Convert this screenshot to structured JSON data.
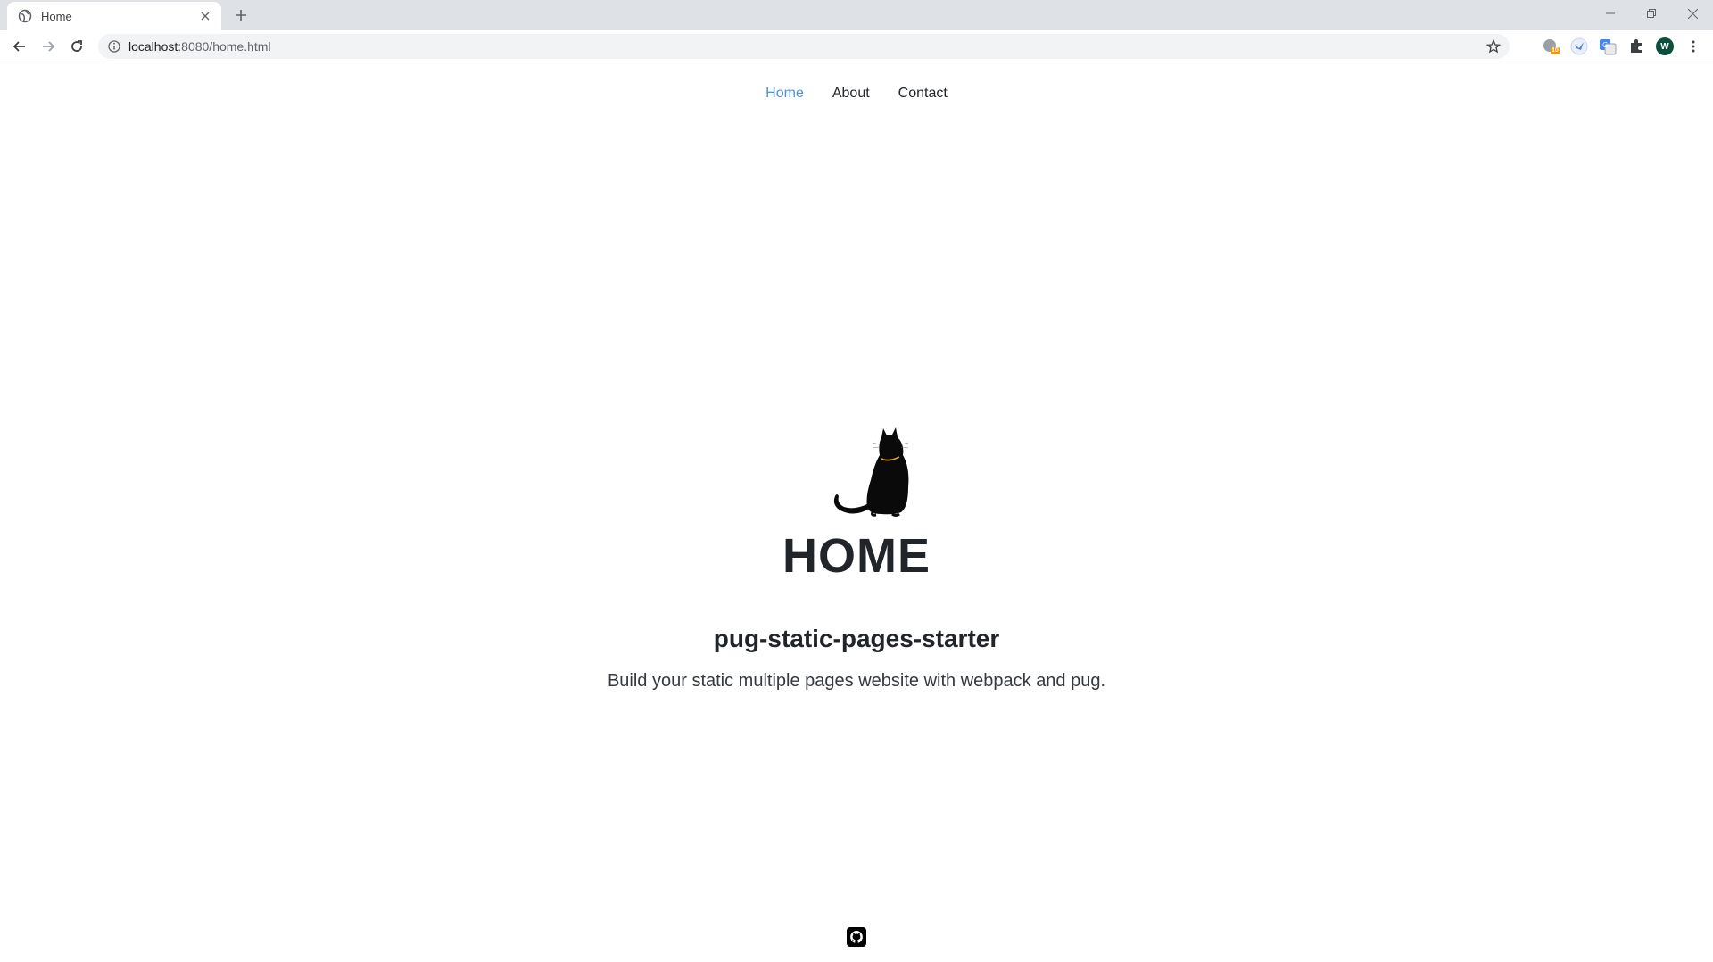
{
  "browser": {
    "tab_title": "Home",
    "url_host": "localhost",
    "url_rest": ":8080/home.html",
    "extension_badge": "10",
    "avatar_letter": "W"
  },
  "nav": {
    "items": [
      {
        "label": "Home",
        "active": true
      },
      {
        "label": "About",
        "active": false
      },
      {
        "label": "Contact",
        "active": false
      }
    ]
  },
  "hero": {
    "title": "HOME",
    "subtitle": "pug-static-pages-starter",
    "description": "Build your static multiple pages website with webpack and pug."
  },
  "footer": {
    "icon": "github-icon"
  },
  "colors": {
    "active_link": "#4a90e2",
    "text": "#212529",
    "tabstrip": "#dee1e6"
  }
}
